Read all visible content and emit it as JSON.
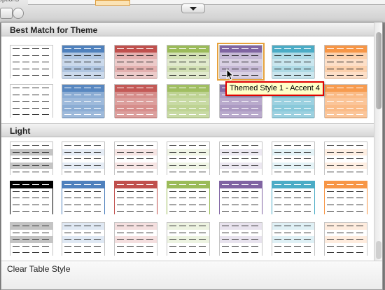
{
  "app": {
    "toolbar_fragment": "options",
    "toolbar_buttons": [
      "table-styles-icon",
      "close-icon"
    ]
  },
  "gallery": {
    "sections": [
      {
        "title": "Best Match for Theme"
      },
      {
        "title": "Light"
      }
    ],
    "selected_style": "Themed Style 1 - Accent 4",
    "clear_label": "Clear Table Style"
  },
  "tooltip": {
    "text": "Themed Style 1 - Accent 4"
  },
  "colors": {
    "neutral": "#555555",
    "accent1": "#4f81bd",
    "accent2": "#c0504d",
    "accent3": "#9bbb59",
    "accent4": "#8064a2",
    "accent5": "#4bacc6",
    "accent6": "#f79646",
    "highlight": "#e6a23c",
    "tooltip_border": "#e00000"
  }
}
